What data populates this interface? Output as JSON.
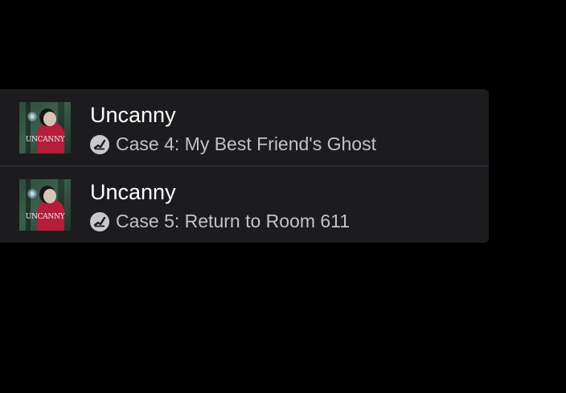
{
  "colors": {
    "background": "#000000",
    "panel": "#1c1c1f",
    "title": "#ffffff",
    "subtitle": "#c3c3c6",
    "artwork_coat": "#b51e3a"
  },
  "episodes": [
    {
      "show": "Uncanny",
      "title": "Case 4: My Best Friend's Ghost",
      "artwork_logo": "UNCANNY",
      "status_icon": "played-check-icon"
    },
    {
      "show": "Uncanny",
      "title": "Case 5: Return to Room 611",
      "artwork_logo": "UNCANNY",
      "status_icon": "played-check-icon"
    }
  ]
}
